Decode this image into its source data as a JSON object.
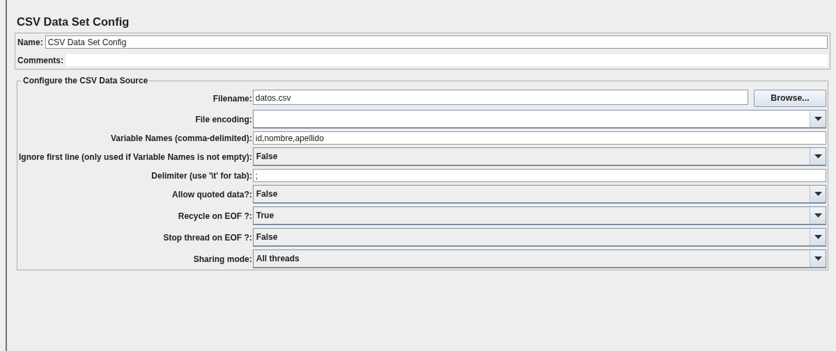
{
  "title": "CSV Data Set Config",
  "name_field": {
    "label": "Name:",
    "value": "CSV Data Set Config"
  },
  "comments_field": {
    "label": "Comments:"
  },
  "group": {
    "title": "Configure the CSV Data Source",
    "rows": [
      {
        "kind": "file",
        "label": "Filename:",
        "value": "datos.csv",
        "button": "Browse..."
      },
      {
        "kind": "combo",
        "label": "File encoding:",
        "editable": true
      },
      {
        "kind": "text",
        "label": "Variable Names (comma-delimited):",
        "value": "id,nombre,apellido"
      },
      {
        "kind": "combo",
        "label": "Ignore first line (only used if Variable Names is not empty):",
        "value": "False",
        "editable": false
      },
      {
        "kind": "text",
        "label": "Delimiter (use '\\t' for tab):",
        "value": ";"
      },
      {
        "kind": "combo",
        "label": "Allow quoted data?:",
        "value": "False",
        "editable": false
      },
      {
        "kind": "combo",
        "label": "Recycle on EOF ?:",
        "value": "True",
        "editable": false
      },
      {
        "kind": "combo",
        "label": "Stop thread on EOF ?:",
        "value": "False",
        "editable": false
      },
      {
        "kind": "combo",
        "label": "Sharing mode:",
        "value": "All threads",
        "editable": false
      }
    ]
  }
}
